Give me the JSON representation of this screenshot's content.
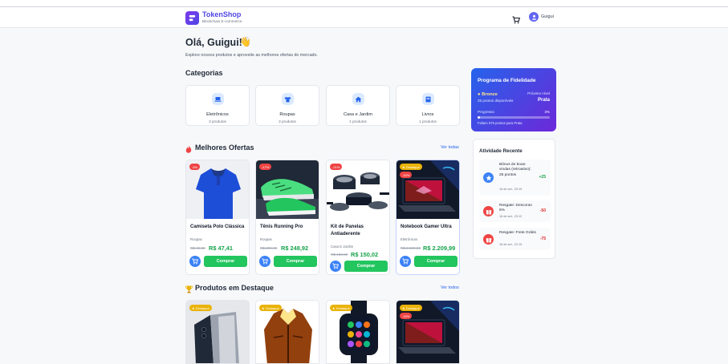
{
  "header": {
    "brand": "TokenShop",
    "brand_sub": "Blockchain E-commerce",
    "user_name": "Guigui"
  },
  "welcome": {
    "title": "Olá, Guigui!",
    "emoji": "👋",
    "subtitle": "Explore nossos produtos e aproveite as melhores ofertas do mercado."
  },
  "categories": {
    "title": "Categorias",
    "items": [
      {
        "name": "Eletrônicos",
        "count": "3 produtos",
        "icon": "laptop-icon"
      },
      {
        "name": "Roupas",
        "count": "3 produtos",
        "icon": "shirt-icon"
      },
      {
        "name": "Casa e Jardim",
        "count": "1 produtos",
        "icon": "home-icon"
      },
      {
        "name": "Livros",
        "count": "1 produtos",
        "icon": "book-icon"
      }
    ]
  },
  "offers": {
    "title": "Melhores Ofertas",
    "see_all": "Ver todas",
    "products": [
      {
        "name": "Camiseta Polo Clássica",
        "category": "Roupas",
        "old_price": "R$ 49,90",
        "price": "R$ 47,41",
        "discount": "-5%",
        "buy": "Comprar"
      },
      {
        "name": "Tênis Running Pro",
        "category": "Roupas",
        "old_price": "R$ 299,90",
        "price": "R$ 248,92",
        "discount": "-17%",
        "buy": "Comprar"
      },
      {
        "name": "Kit de Panelas Antiaderente",
        "category": "Casa E Jardim",
        "old_price": "R$ 189,90",
        "price": "R$ 150,02",
        "discount": "-21%",
        "buy": "Comprar"
      },
      {
        "name": "Notebook Gamer Ultra",
        "category": "Eletrônicos",
        "old_price": "R$ 2.599,90",
        "price": "R$ 2.209,99",
        "discount": "-15%",
        "featured": "Destaque",
        "buy": "Comprar"
      }
    ]
  },
  "featured": {
    "title": "Produtos em Destaque",
    "see_all": "Ver todos",
    "badge": "Destaque",
    "notebook_discount": "-15%"
  },
  "loyalty": {
    "title": "Programa de Fidelidade",
    "tier": "Bronze",
    "points": "25 pontos disponíveis",
    "next_label": "Próximo nível",
    "next_value": "Prata",
    "progress_label": "Progresso",
    "progress_pct": "3%",
    "progress_value": 0.03,
    "remaining": "Faltam 975 pontos para Prata"
  },
  "activity": {
    "title": "Atividade Recente",
    "items": [
      {
        "text": "Bônus de boas-vindas (retroativo): 25 pontos",
        "date": "16 de set., 23:19",
        "value": "+25",
        "color": "#16a34a",
        "icon": "star-icon",
        "icon_bg": "#3b82f6"
      },
      {
        "text": "Resgate: Desconto 5%",
        "date": "16 de set., 23:12",
        "value": "-50",
        "color": "#dc2626",
        "icon": "gift-icon",
        "icon_bg": "#ef4444"
      },
      {
        "text": "Resgate: Frete Grátis",
        "date": "16 de set., 22:19",
        "value": "-75",
        "color": "#dc2626",
        "icon": "gift-icon",
        "icon_bg": "#ef4444"
      }
    ]
  },
  "colors": {
    "primary": "#4f46e5",
    "green": "#22c55e",
    "blue": "#3b82f6",
    "red": "#ef4444"
  }
}
